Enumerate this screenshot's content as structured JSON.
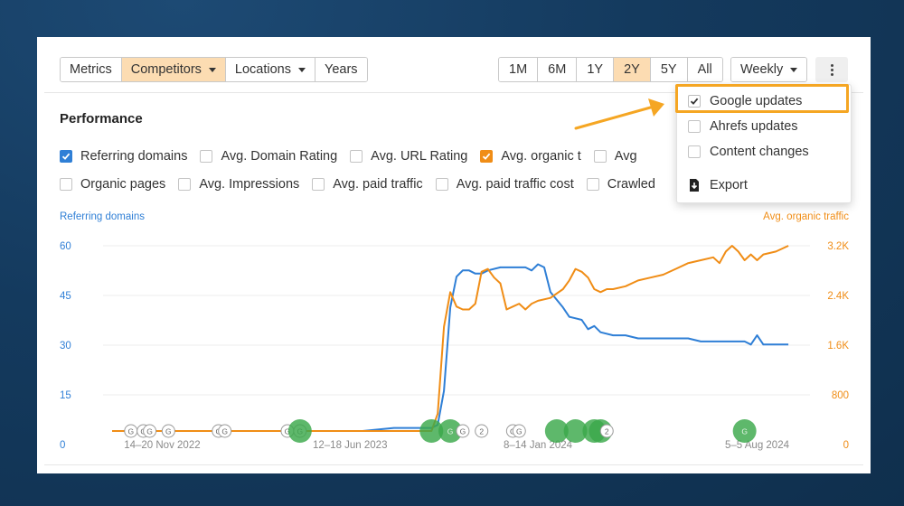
{
  "toolbar": {
    "left_group": [
      {
        "label": "Metrics",
        "active": false,
        "caret": false
      },
      {
        "label": "Competitors",
        "active": true,
        "caret": true
      },
      {
        "label": "Locations",
        "active": false,
        "caret": true
      },
      {
        "label": "Years",
        "active": false,
        "caret": false
      }
    ],
    "range_group": [
      {
        "label": "1M",
        "active": false
      },
      {
        "label": "6M",
        "active": false
      },
      {
        "label": "1Y",
        "active": false
      },
      {
        "label": "2Y",
        "active": true
      },
      {
        "label": "5Y",
        "active": false
      },
      {
        "label": "All",
        "active": false
      }
    ],
    "interval_label": "Weekly",
    "more_icon": "kebab-vertical-icon"
  },
  "section_title": "Performance",
  "metrics_row1": [
    {
      "label": "Referring domains",
      "checked": true,
      "color": "#2f7fd6"
    },
    {
      "label": "Avg. Domain Rating",
      "checked": false
    },
    {
      "label": "Avg. URL Rating",
      "checked": false
    },
    {
      "label": "Avg. organic t",
      "checked": true,
      "color": "#f08d16"
    },
    {
      "label": "Avg",
      "checked": false
    }
  ],
  "metrics_row2": [
    {
      "label": "Organic pages",
      "checked": false
    },
    {
      "label": "Avg. Impressions",
      "checked": false
    },
    {
      "label": "Avg. paid traffic",
      "checked": false
    },
    {
      "label": "Avg. paid traffic cost",
      "checked": false
    },
    {
      "label": "Crawled",
      "checked": false
    }
  ],
  "menu": {
    "items": [
      {
        "label": "Google updates",
        "checked": true
      },
      {
        "label": "Ahrefs updates",
        "checked": false
      },
      {
        "label": "Content changes",
        "checked": false
      }
    ],
    "export_label": "Export",
    "export_icon": "download-icon",
    "highlight_color": "#f5a623"
  },
  "annotation_arrow_color": "#f5a623",
  "chart_data": {
    "type": "line",
    "left_axis_title": "Referring domains",
    "right_axis_title": "Avg. organic traffic",
    "left_ticks": [
      "60",
      "45",
      "30",
      "15",
      "0"
    ],
    "right_ticks": [
      "3.2K",
      "2.4K",
      "1.6K",
      "800",
      "0"
    ],
    "left_ylim": [
      0,
      60
    ],
    "right_ylim": [
      0,
      3200
    ],
    "x_tick_labels": [
      "14–20 Nov 2022",
      "12–18 Jun 2023",
      "8–14 Jan 2024",
      "5–5 Aug 2024"
    ],
    "x_range_weeks": [
      0,
      110
    ],
    "x_tick_weeks": [
      8,
      38,
      68,
      103
    ],
    "grid": true,
    "series": [
      {
        "name": "Referring domains",
        "axis": "left",
        "color": "#2f7fd6",
        "points": [
          [
            0,
            0
          ],
          [
            20,
            0
          ],
          [
            40,
            0
          ],
          [
            45,
            1
          ],
          [
            51,
            1
          ],
          [
            52,
            2
          ],
          [
            53,
            13
          ],
          [
            54,
            40
          ],
          [
            55,
            50
          ],
          [
            56,
            52
          ],
          [
            57,
            52
          ],
          [
            58,
            51
          ],
          [
            59,
            51
          ],
          [
            60,
            52
          ],
          [
            62,
            53
          ],
          [
            66,
            53
          ],
          [
            67,
            52
          ],
          [
            68,
            54
          ],
          [
            69,
            53
          ],
          [
            70,
            45
          ],
          [
            72,
            40
          ],
          [
            73,
            37
          ],
          [
            75,
            36
          ],
          [
            76,
            33
          ],
          [
            77,
            34
          ],
          [
            78,
            32
          ],
          [
            80,
            31
          ],
          [
            82,
            31
          ],
          [
            84,
            30
          ],
          [
            86,
            30
          ],
          [
            88,
            30
          ],
          [
            92,
            30
          ],
          [
            94,
            29
          ],
          [
            96,
            29
          ],
          [
            98,
            29
          ],
          [
            100,
            29
          ],
          [
            101,
            29
          ],
          [
            102,
            28
          ],
          [
            103,
            31
          ],
          [
            104,
            28
          ],
          [
            106,
            28
          ],
          [
            108,
            28
          ]
        ]
      },
      {
        "name": "Avg. organic traffic",
        "axis": "right",
        "color": "#f08d16",
        "points": [
          [
            0,
            0
          ],
          [
            40,
            0
          ],
          [
            45,
            0
          ],
          [
            51,
            0
          ],
          [
            52,
            300
          ],
          [
            53,
            1800
          ],
          [
            54,
            2400
          ],
          [
            55,
            2150
          ],
          [
            56,
            2100
          ],
          [
            57,
            2100
          ],
          [
            58,
            2200
          ],
          [
            59,
            2750
          ],
          [
            60,
            2800
          ],
          [
            61,
            2650
          ],
          [
            62,
            2550
          ],
          [
            63,
            2100
          ],
          [
            64,
            2150
          ],
          [
            65,
            2200
          ],
          [
            66,
            2100
          ],
          [
            67,
            2200
          ],
          [
            68,
            2250
          ],
          [
            70,
            2300
          ],
          [
            72,
            2450
          ],
          [
            73,
            2600
          ],
          [
            74,
            2800
          ],
          [
            75,
            2750
          ],
          [
            76,
            2650
          ],
          [
            77,
            2450
          ],
          [
            78,
            2400
          ],
          [
            79,
            2450
          ],
          [
            80,
            2450
          ],
          [
            82,
            2500
          ],
          [
            84,
            2600
          ],
          [
            86,
            2650
          ],
          [
            88,
            2700
          ],
          [
            90,
            2800
          ],
          [
            92,
            2900
          ],
          [
            94,
            2950
          ],
          [
            96,
            3000
          ],
          [
            97,
            2900
          ],
          [
            98,
            3100
          ],
          [
            99,
            3200
          ],
          [
            100,
            3100
          ],
          [
            101,
            2950
          ],
          [
            102,
            3050
          ],
          [
            103,
            2950
          ],
          [
            104,
            3050
          ],
          [
            106,
            3100
          ],
          [
            108,
            3200
          ]
        ]
      }
    ],
    "events": [
      {
        "week": 3,
        "kind": "google-update",
        "label": "G"
      },
      {
        "week": 5,
        "kind": "google-update",
        "label": "G"
      },
      {
        "week": 6,
        "kind": "google-update",
        "label": "G"
      },
      {
        "week": 9,
        "kind": "google-update",
        "label": "G"
      },
      {
        "week": 17,
        "kind": "google-update",
        "label": "G"
      },
      {
        "week": 18,
        "kind": "google-update",
        "label": "G"
      },
      {
        "week": 28,
        "kind": "google-update",
        "label": "G"
      },
      {
        "week": 30,
        "kind": "google-update",
        "label": "G"
      },
      {
        "week": 30,
        "kind": "content-change",
        "label": ""
      },
      {
        "week": 51,
        "kind": "content-change",
        "label": ""
      },
      {
        "week": 54,
        "kind": "content-change",
        "label": "G"
      },
      {
        "week": 56,
        "kind": "google-update",
        "label": "G"
      },
      {
        "week": 59,
        "kind": "google-update",
        "label": "2"
      },
      {
        "week": 64,
        "kind": "google-update",
        "label": "G"
      },
      {
        "week": 65,
        "kind": "google-update",
        "label": "G"
      },
      {
        "week": 71,
        "kind": "content-change",
        "label": ""
      },
      {
        "week": 74,
        "kind": "content-change",
        "label": ""
      },
      {
        "week": 77,
        "kind": "content-change",
        "label": ""
      },
      {
        "week": 78,
        "kind": "content-change",
        "label": ""
      },
      {
        "week": 79,
        "kind": "google-update",
        "label": "2"
      },
      {
        "week": 101,
        "kind": "content-change",
        "label": "G"
      }
    ]
  }
}
